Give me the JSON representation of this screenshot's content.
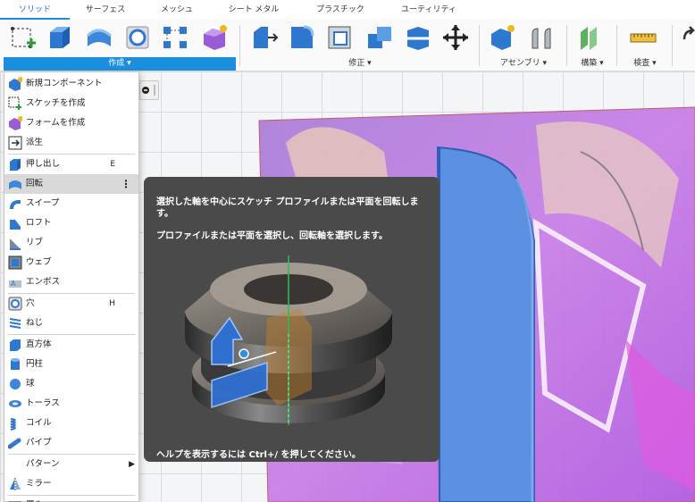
{
  "tabs": [
    "ソリッド",
    "サーフェス",
    "メッシュ",
    "シート メタル",
    "プラスチック",
    "ユーティリティ"
  ],
  "ribbon": {
    "groups": {
      "create": "作成 ▾",
      "modify": "修正 ▾",
      "assemble": "アセンブリ ▾",
      "construct": "構築 ▾",
      "inspect": "検査 ▾"
    },
    "tools": [
      "new-sketch-icon",
      "extrude-icon",
      "revolve-icon",
      "hole-icon",
      "pattern-icon",
      "new-form-icon",
      "press-pull-icon",
      "fillet-icon",
      "shell-icon",
      "combine-icon",
      "split-face-icon",
      "move-icon",
      "new-component-icon",
      "joint-icon",
      "offset-plane-icon",
      "measure-icon",
      "insert-icon"
    ]
  },
  "menu": {
    "items": [
      {
        "label": "新規コンポーネント",
        "icon": "new-component-icon"
      },
      {
        "label": "スケッチを作成",
        "icon": "create-sketch-icon"
      },
      {
        "label": "フォームを作成",
        "icon": "create-form-icon"
      },
      {
        "label": "派生",
        "icon": "derive-icon"
      },
      {
        "label": "押し出し",
        "icon": "extrude-icon",
        "shortcut": "E"
      },
      {
        "label": "回転",
        "icon": "revolve-icon",
        "more": "⋮"
      },
      {
        "label": "スイープ",
        "icon": "sweep-icon"
      },
      {
        "label": "ロフト",
        "icon": "loft-icon"
      },
      {
        "label": "リブ",
        "icon": "rib-icon"
      },
      {
        "label": "ウェブ",
        "icon": "web-icon"
      },
      {
        "label": "エンボス",
        "icon": "emboss-icon"
      },
      {
        "label": "穴",
        "icon": "hole-icon",
        "shortcut": "H"
      },
      {
        "label": "ねじ",
        "icon": "thread-icon"
      },
      {
        "label": "直方体",
        "icon": "box-icon"
      },
      {
        "label": "円柱",
        "icon": "cylinder-icon"
      },
      {
        "label": "球",
        "icon": "sphere-icon"
      },
      {
        "label": "トーラス",
        "icon": "torus-icon"
      },
      {
        "label": "コイル",
        "icon": "coil-icon"
      },
      {
        "label": "パイプ",
        "icon": "pipe-icon"
      },
      {
        "label": "パターン",
        "arrow": "▶"
      },
      {
        "label": "ミラー",
        "icon": "mirror-icon"
      },
      {
        "label": "厚み",
        "icon": "thicken-icon"
      }
    ]
  },
  "tooltip": {
    "description": "選択した軸を中心にスケッチ プロファイルまたは平面を回転します。",
    "instruction": "プロファイルまたは平面を選択し、回転軸を選択します。",
    "help": "ヘルプを表示するには Ctrl+/ を押してください。"
  },
  "colors": {
    "accent": "#1a8fe0",
    "tooltip_bg": "#4a4a4a",
    "body_blue": "#5b8fe0",
    "sketch_purple": "#9a74d6"
  }
}
